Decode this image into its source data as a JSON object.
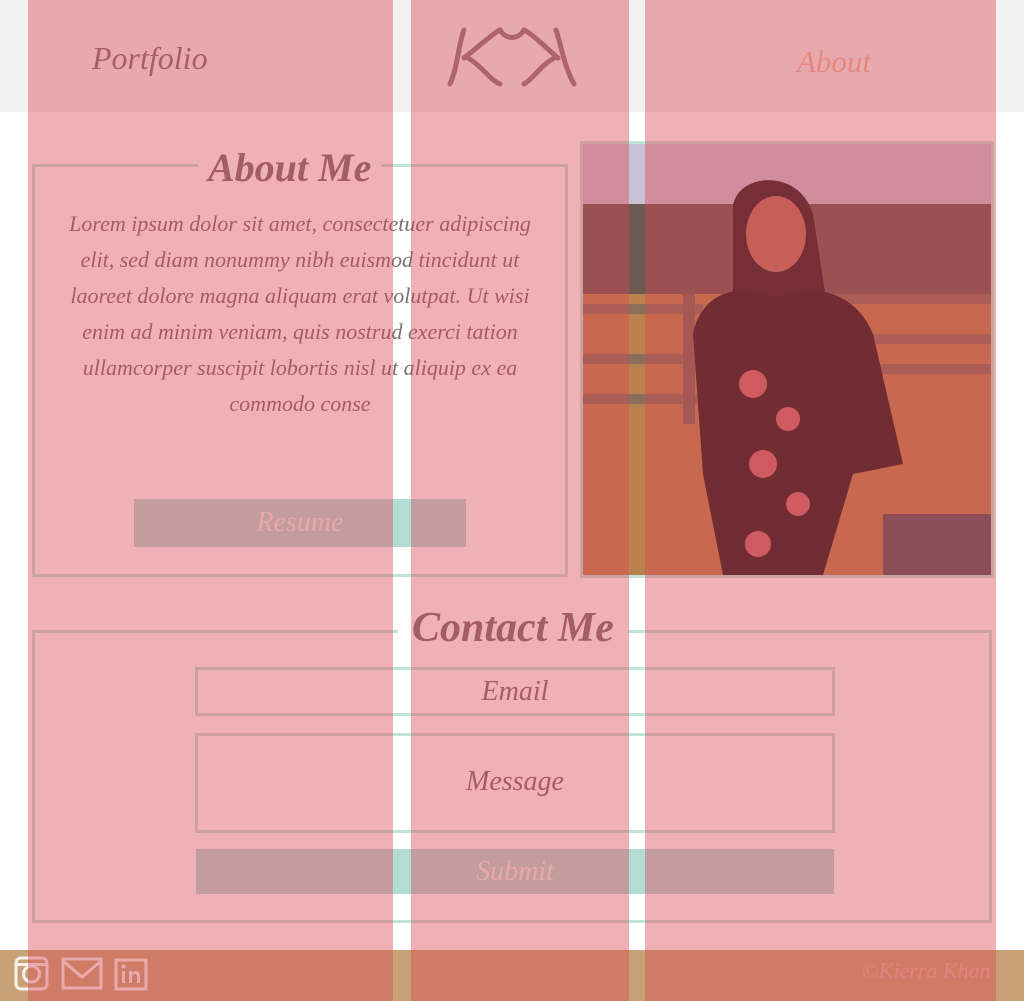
{
  "header": {
    "nav_portfolio": "Portfolio",
    "nav_about": "About",
    "logo_text": "KK"
  },
  "about": {
    "title": "About Me",
    "body": "Lorem ipsum dolor sit amet, consectetuer adipiscing elit, sed diam nonummy nibh euismod tincidunt ut laoreet dolore magna aliquam erat volutpat. Ut wisi enim ad minim veniam, quis nostrud exerci tation ullamcorper suscipit lobortis nisl ut aliquip ex ea commodo conse",
    "resume_label": "Resume"
  },
  "contact": {
    "title": "Contact Me",
    "email_placeholder": "Email",
    "message_placeholder": "Message",
    "submit_label": "Submit"
  },
  "footer": {
    "copyright": "©Kierra Khan",
    "icons": [
      "instagram-icon",
      "mail-icon",
      "linkedin-icon"
    ]
  },
  "colors": {
    "accent_mint": "#b2ddd5",
    "text_mauve": "#7a6f72",
    "footer_tan": "#c8a276",
    "overlay_red": "#dc4650"
  }
}
